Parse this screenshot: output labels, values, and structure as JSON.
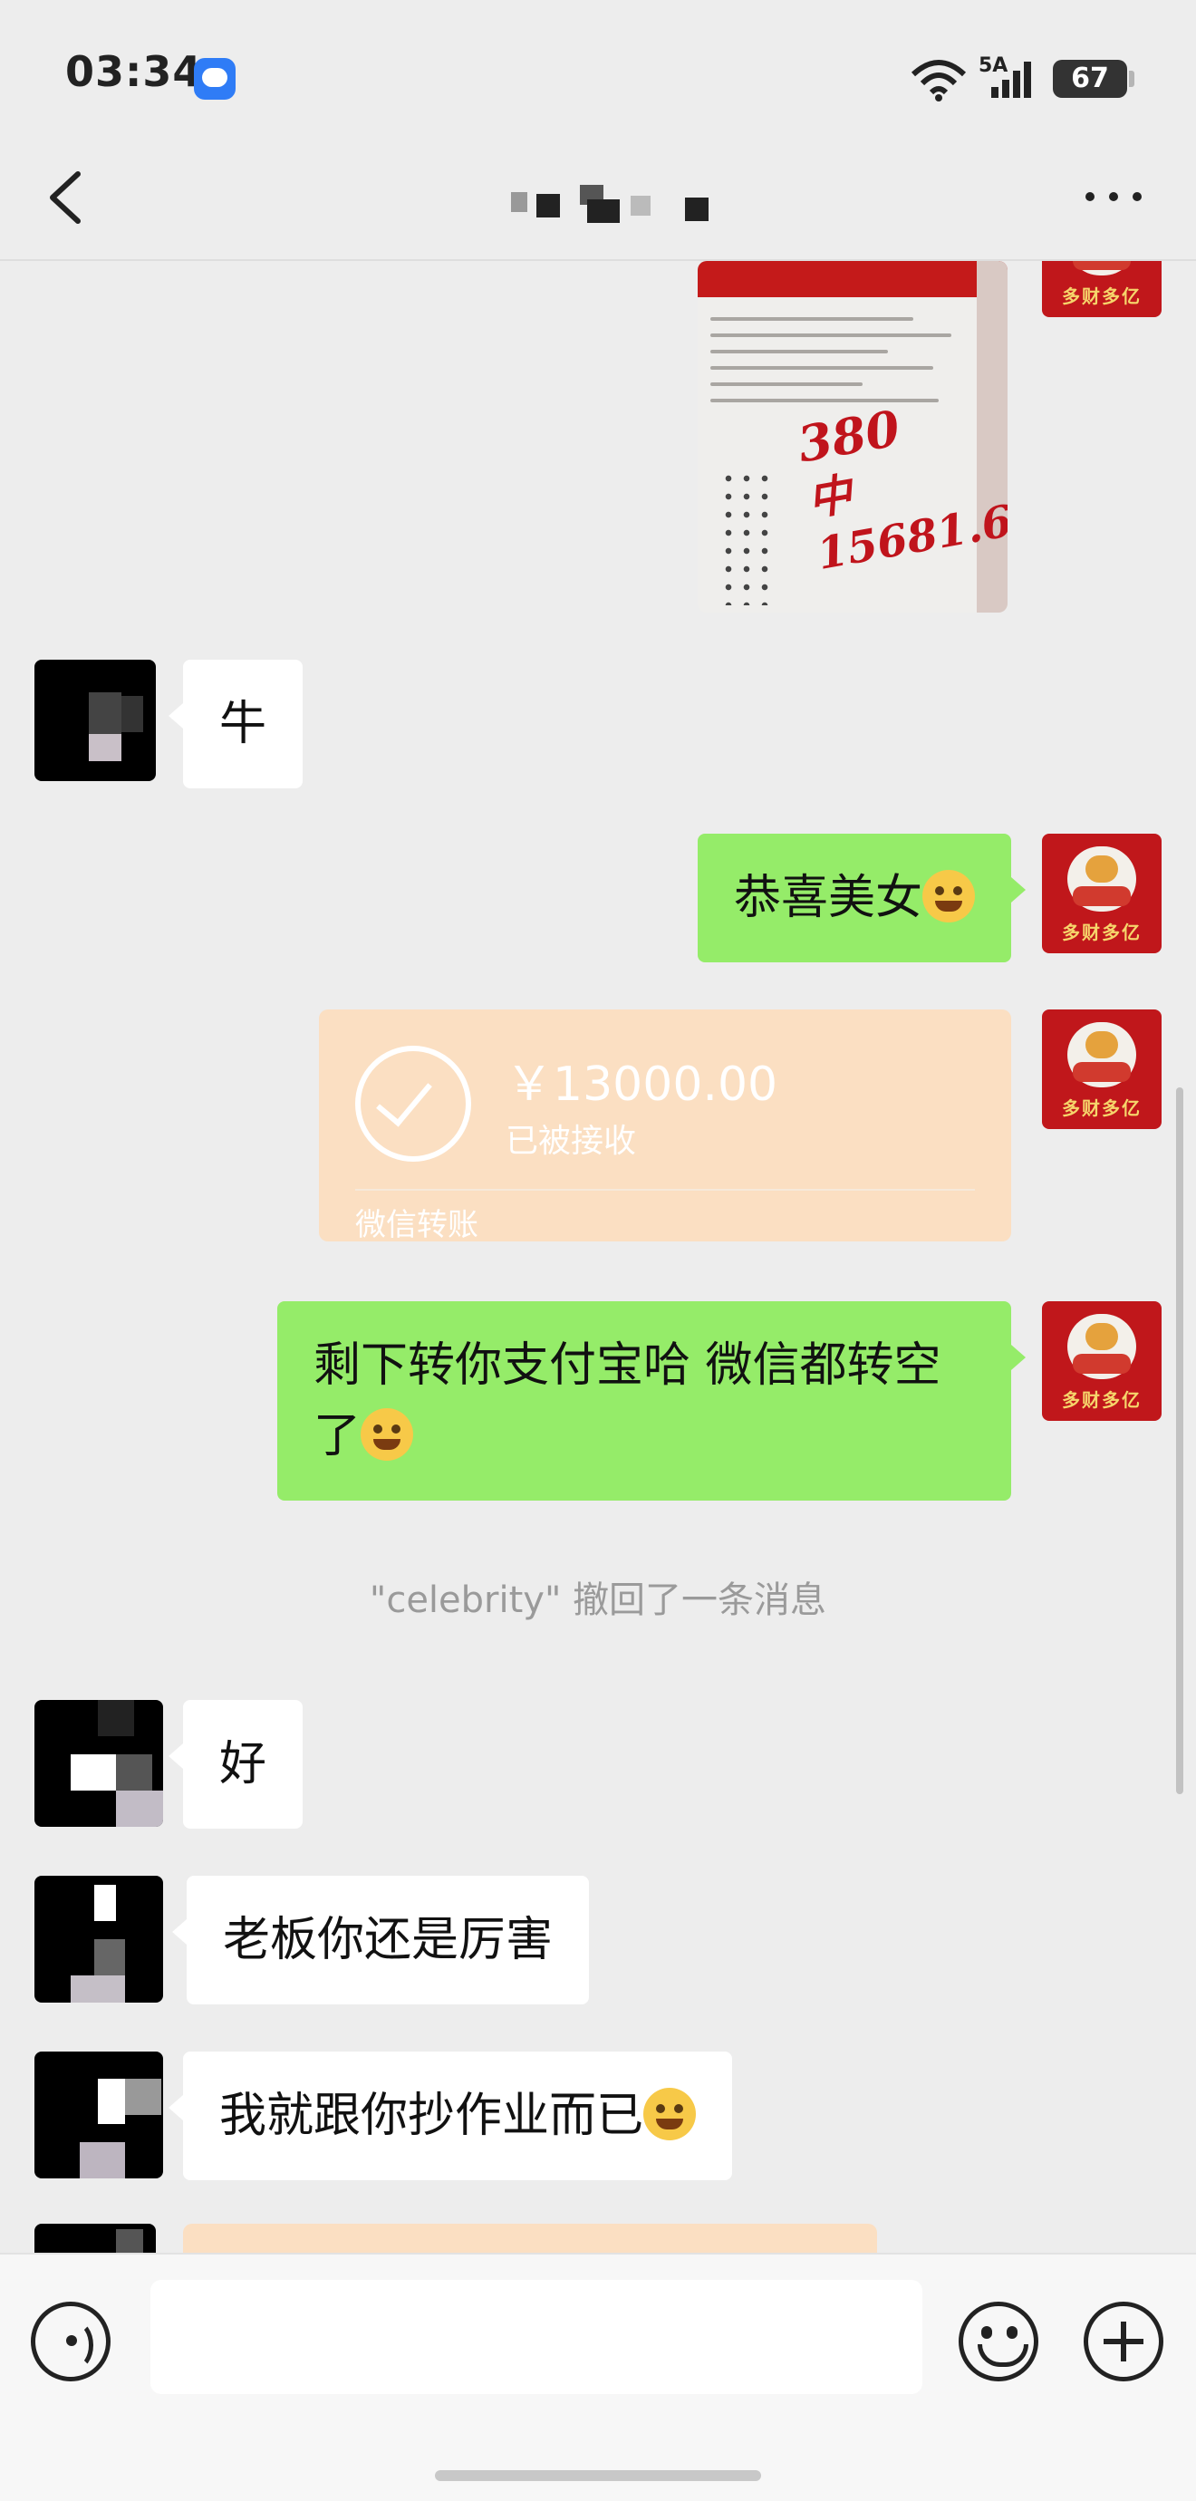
{
  "status_bar": {
    "time": "03:34",
    "network": "5A",
    "battery": "67"
  },
  "header": {
    "back_icon": "chevron-left-icon",
    "more_icon": "more-dots-icon"
  },
  "messages": [
    {
      "id": "m0",
      "from": "me",
      "type": "image",
      "description_icon": "lottery-ticket-photo",
      "handwriting": [
        "380",
        "中15681.6"
      ]
    },
    {
      "id": "m1",
      "from": "other",
      "type": "text",
      "text": "牛"
    },
    {
      "id": "m2",
      "from": "me",
      "type": "text",
      "text": "恭喜美女",
      "emoji": "blush-emoji"
    },
    {
      "id": "m3",
      "from": "me",
      "type": "transfer",
      "amount": "￥13000.00",
      "status": "已被接收",
      "label": "微信转账"
    },
    {
      "id": "m4",
      "from": "me",
      "type": "text",
      "text": "剩下转你支付宝哈 微信都转空了",
      "emoji": "crying-laughing-emoji"
    },
    {
      "id": "m5",
      "type": "system",
      "text": "\"celebrity\" 撤回了一条消息"
    },
    {
      "id": "m6",
      "from": "other",
      "type": "text",
      "text": "好"
    },
    {
      "id": "m7",
      "from": "other",
      "type": "text",
      "text": "老板你还是厉害"
    },
    {
      "id": "m8",
      "from": "other",
      "type": "text",
      "text": "我就跟你抄作业而已",
      "emoji": "grinning-emoji"
    }
  ],
  "my_avatar": {
    "caption": "多财多亿"
  },
  "input_bar": {
    "placeholder": "",
    "voice_icon": "voice-icon",
    "emoji_icon": "emoji-face-icon",
    "plus_icon": "plus-icon"
  },
  "colors": {
    "background": "#ededed",
    "outgoing_bubble": "#95ec69",
    "incoming_bubble": "#ffffff",
    "transfer_card": "#fbdfc2",
    "system_text": "#9a9a9a"
  }
}
